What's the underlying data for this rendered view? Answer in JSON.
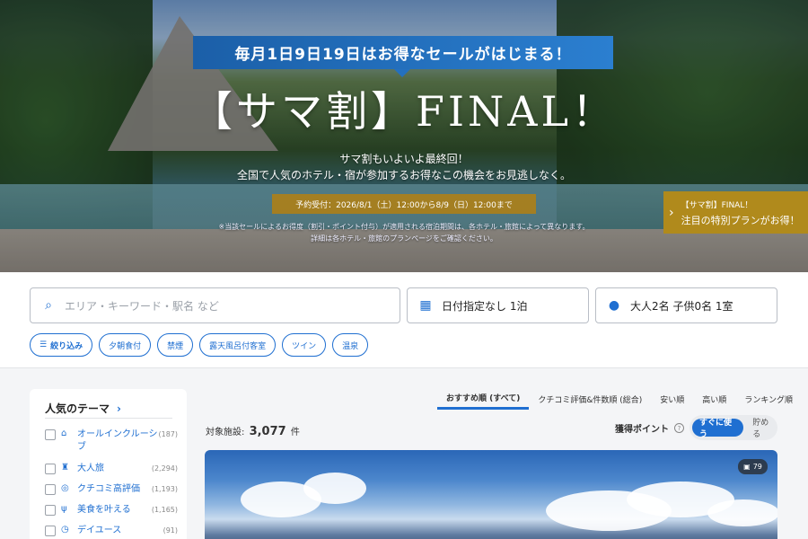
{
  "hero": {
    "banner": "毎月1日9日19日はお得なセールがはじまる！",
    "title": "【サマ割】FINAL！",
    "line1": "サマ割もいよいよ最終回！",
    "line2": "全国で人気のホテル・宿が参加するお得なこの機会をお見逃しなく。",
    "period": "予約受付：2026/8/1（土）12:00から8/9（日）12:00まで",
    "note1": "※当該セールによるお得度（割引・ポイント付与）が適用される宿泊期間は、各ホテル・旅館によって異なります。",
    "note2": "詳細は各ホテル・旅館のプランページをご確認ください。",
    "promo_line1": "【サマ割】FINAL！",
    "promo_line2": "注目の特別プランがお得！"
  },
  "search": {
    "keyword_placeholder": "エリア・キーワード・駅名 など",
    "date": "日付指定なし 1泊",
    "guests": "大人2名  子供0名  1室"
  },
  "chips": [
    "絞り込み",
    "夕朝食付",
    "禁煙",
    "露天風呂付客室",
    "ツイン",
    "温泉"
  ],
  "sidebar": {
    "title": "人気のテーマ",
    "themes": [
      {
        "label": "オールインクルーシブ",
        "count": "(187)",
        "icon": "all-inclusive-icon"
      },
      {
        "label": "大人旅",
        "count": "(2,294)",
        "icon": "adult-trip-icon"
      },
      {
        "label": "クチコミ高評価",
        "count": "(1,193)",
        "icon": "review-icon"
      },
      {
        "label": "美食を叶える",
        "count": "(1,165)",
        "icon": "dining-icon"
      },
      {
        "label": "デイユース",
        "count": "(91)",
        "icon": "clock-icon"
      }
    ]
  },
  "sort_tabs": [
    "おすすめ順 (すべて)",
    "クチコミ評価&件数順 (総合)",
    "安い順",
    "高い順",
    "ランキング順"
  ],
  "results": {
    "label": "対象施設:",
    "count": "3,077",
    "unit": "件",
    "points_label": "獲得ポイント",
    "points_help": "?",
    "toggle_on": "すぐに使う",
    "toggle_off": "貯める",
    "photo_count": "79"
  }
}
